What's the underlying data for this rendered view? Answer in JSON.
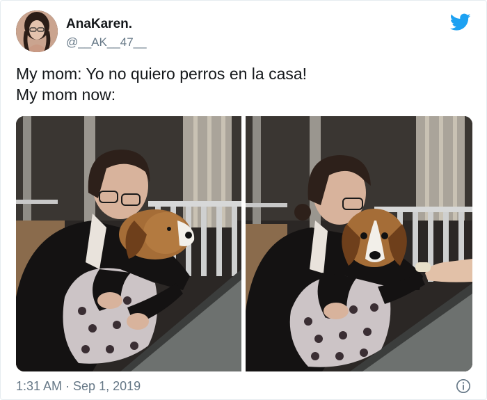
{
  "tweet": {
    "author_name": "AnaKaren.",
    "author_handle": "@__AK__47__",
    "text_lines": [
      "My mom: Yo no quiero perros en la casa!",
      "My mom now:"
    ],
    "timestamp": "1:31 AM · Sep 1, 2019"
  },
  "photos": {
    "left": {
      "description_icon": "photo-mom-hugging-beagle"
    },
    "right": {
      "description_icon": "photo-mom-feeding-beagle"
    }
  },
  "icons": {
    "brand": "twitter-bird-icon",
    "info": "info-icon"
  },
  "colors": {
    "twitter_blue": "#1da1f2",
    "secondary_text": "#657786",
    "primary_text": "#14171a"
  }
}
